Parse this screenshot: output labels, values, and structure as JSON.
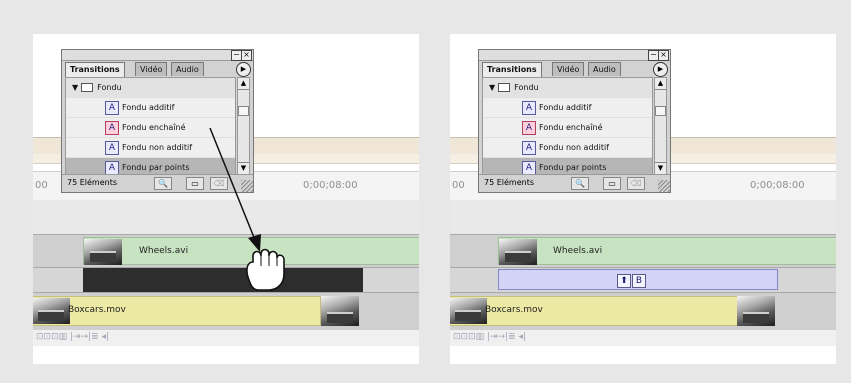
{
  "palette": {
    "tabs": [
      "Transitions",
      "Vidéo",
      "Audio"
    ],
    "active_tab": "Transitions",
    "folder": "Fondu",
    "items": [
      "Fondu additif",
      "Fondu enchaîné",
      "Fondu non additif",
      "Fondu par points"
    ],
    "selected_item": "Fondu par points",
    "item_count": "75 Eléments",
    "icon_glyph": "A"
  },
  "timeline": {
    "time_start": "00",
    "time_mark": "0;00;08:00",
    "video_clip": "Wheels.avi",
    "audio_clip": "Boxcars.mov",
    "bottom_controls": "⊡⊡⊡▥ |⇥→|≣ ◂|"
  },
  "right_panel": {
    "transition_glyph": "B",
    "track_select_glyph": "⬆"
  },
  "colors": {
    "wheels_clip": "#c8e3c2",
    "boxcars_clip": "#ece9a4",
    "transition_clip": "#d3d3f7",
    "gap": "#2d2d2d"
  }
}
